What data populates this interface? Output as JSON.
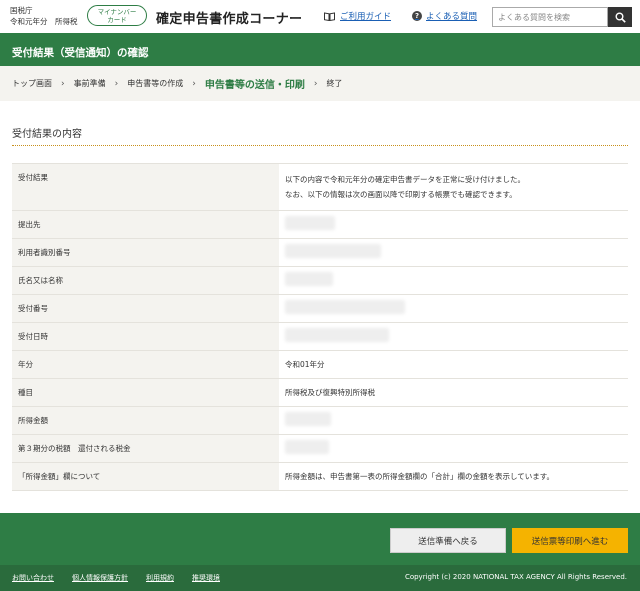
{
  "header": {
    "agency_name": "国税庁",
    "agency_sub": "令和元年分　所得税",
    "mynumber_badge": [
      "マイナンバー",
      "カード"
    ],
    "site_title": "確定申告書作成コーナー",
    "guide_link": "ご利用ガイド",
    "faq_link": "よくある質問",
    "search_placeholder": "よくある質問を検索"
  },
  "page_title": "受付結果（受信通知）の確認",
  "breadcrumb": {
    "items": [
      "トップ画面",
      "事前準備",
      "申告書等の作成",
      "申告書等の送信・印刷",
      "終了"
    ],
    "current_index": 3
  },
  "section": {
    "title": "受付結果の内容"
  },
  "table": {
    "rows": [
      {
        "label": "受付結果",
        "value_lines": [
          "以下の内容で令和元年分の確定申告書データを正常に受け付けました。",
          "なお、以下の情報は次の画面以降で印刷する帳票でも確認できます。"
        ]
      },
      {
        "label": "提出先",
        "value": ""
      },
      {
        "label": "利用者識別番号",
        "value": ""
      },
      {
        "label": "氏名又は名称",
        "value": ""
      },
      {
        "label": "受付番号",
        "value": ""
      },
      {
        "label": "受付日時",
        "value": ""
      },
      {
        "label": "年分",
        "value": "令和01年分"
      },
      {
        "label": "種目",
        "value": "所得税及び復興特別所得税"
      },
      {
        "label": "所得金額",
        "value": ""
      },
      {
        "label": "第３期分の税額　還付される税金",
        "value": ""
      },
      {
        "label": "「所得金額」欄について",
        "value": "所得金額は、申告書第一表の所得金額欄の「合計」欄の金額を表示しています。"
      }
    ]
  },
  "actions": {
    "back_label": "送信準備へ戻る",
    "next_label": "送信票等印刷へ進む"
  },
  "footer": {
    "links": [
      "お問い合わせ",
      "個人情報保護方針",
      "利用規約",
      "推奨環境"
    ],
    "copyright": "Copyright (c) 2020 NATIONAL TAX AGENCY All Rights Reserved."
  },
  "colors": {
    "brand_green": "#2e7d45",
    "accent_orange": "#f5b300",
    "link_blue": "#1a5fb4"
  }
}
